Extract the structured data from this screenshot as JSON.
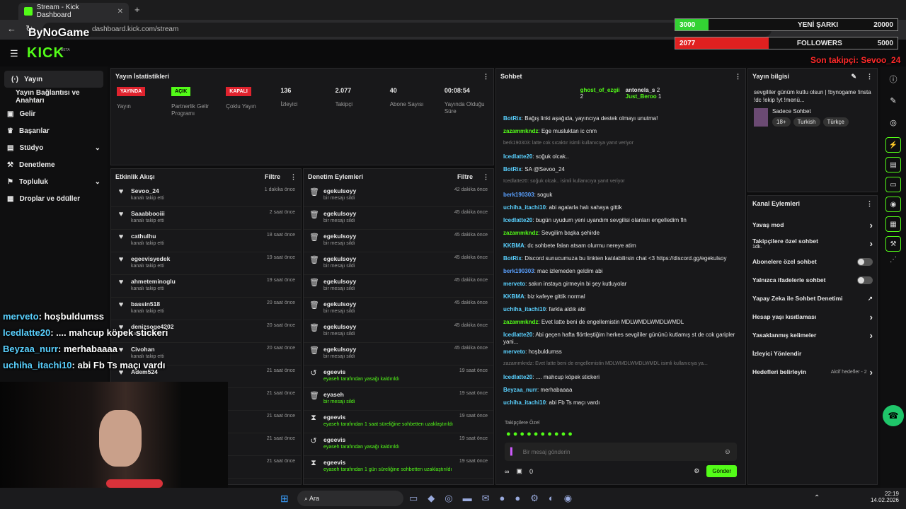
{
  "browser": {
    "tab_title": "Stream - Kick Dashboard",
    "url": "dashboard.kick.com/stream"
  },
  "brand": {
    "logo": "KICK",
    "beta": "BETA"
  },
  "sidebar": {
    "items": [
      {
        "label": "Yayın",
        "icon": "stream-icon"
      },
      {
        "label": "Yayın Bağlantısı ve Anahtarı",
        "icon": "key-icon"
      },
      {
        "label": "Gelir",
        "icon": "wallet-icon"
      },
      {
        "label": "Başarılar",
        "icon": "trophy-icon"
      },
      {
        "label": "Stüdyo",
        "icon": "studio-icon"
      },
      {
        "label": "Denetleme",
        "icon": "hammer-icon"
      },
      {
        "label": "Topluluk",
        "icon": "community-icon"
      },
      {
        "label": "Droplar ve ödüller",
        "icon": "drops-icon"
      }
    ]
  },
  "stats": {
    "title": "Yayın İstatistikleri",
    "items": [
      {
        "badge": "YAYINDA",
        "label": "Yayın"
      },
      {
        "badge": "AÇIK",
        "label": "Partnerlik Gelir Programı"
      },
      {
        "badge": "KAPALI",
        "label": "Çoklu Yayın"
      },
      {
        "value": "136",
        "label": "İzleyici"
      },
      {
        "value": "2.077",
        "label": "Takipçi"
      },
      {
        "value": "40",
        "label": "Abone Sayısı"
      },
      {
        "value": "00:08:54",
        "label": "Yayında Olduğu Süre"
      }
    ]
  },
  "activity": {
    "title": "Etkinlik Akışı",
    "filter": "Filtre",
    "rows": [
      {
        "name": "Sevoo_24",
        "sub": "kanalı takip etti",
        "time": "1 dakika önce"
      },
      {
        "name": "Saaabbooiii",
        "sub": "kanalı takip etti",
        "time": "2 saat önce"
      },
      {
        "name": "cathulhu",
        "sub": "kanalı takip etti",
        "time": "18 saat önce"
      },
      {
        "name": "egeevisyedek",
        "sub": "kanalı takip etti",
        "time": "19 saat önce"
      },
      {
        "name": "ahmeteminoglu",
        "sub": "kanalı takip etti",
        "time": "19 saat önce"
      },
      {
        "name": "bassin518",
        "sub": "kanalı takip etti",
        "time": "20 saat önce"
      },
      {
        "name": "denizsoge4202",
        "sub": "kanalı takip etti",
        "time": "20 saat önce"
      },
      {
        "name": "Civohan",
        "sub": "kanalı takip etti",
        "time": "20 saat önce"
      },
      {
        "name": "Adem524",
        "sub": "",
        "time": "21 saat önce"
      },
      {
        "name": "",
        "sub": "",
        "time": "21 saat önce"
      },
      {
        "name": "",
        "sub": "",
        "time": "21 saat önce"
      },
      {
        "name": "",
        "sub": "",
        "time": "21 saat önce"
      },
      {
        "name": "",
        "sub": "",
        "time": "21 saat önce"
      }
    ]
  },
  "mod": {
    "title": "Denetim Eylemleri",
    "filter": "Filtre",
    "rows": [
      {
        "icon": "trash-icon",
        "name": "egekulsoyy",
        "sub": "bir mesajı sildi",
        "time": "42 dakika önce"
      },
      {
        "icon": "trash-icon",
        "name": "egekulsoyy",
        "sub": "bir mesajı sildi",
        "time": "45 dakika önce"
      },
      {
        "icon": "trash-icon",
        "name": "egekulsoyy",
        "sub": "bir mesajı sildi",
        "time": "45 dakika önce"
      },
      {
        "icon": "trash-icon",
        "name": "egekulsoyy",
        "sub": "bir mesajı sildi",
        "time": "45 dakika önce"
      },
      {
        "icon": "trash-icon",
        "name": "egekulsoyy",
        "sub": "bir mesajı sildi",
        "time": "45 dakika önce"
      },
      {
        "icon": "trash-icon",
        "name": "egekulsoyy",
        "sub": "bir mesajı sildi",
        "time": "45 dakika önce"
      },
      {
        "icon": "trash-icon",
        "name": "egekulsoyy",
        "sub": "bir mesajı sildi",
        "time": "45 dakika önce"
      },
      {
        "icon": "trash-icon",
        "name": "egekulsoyy",
        "sub": "bir mesajı sildi",
        "time": "45 dakika önce"
      },
      {
        "icon": "undo-icon",
        "name": "egeevis",
        "sub": "eyaseh tarafından yasağı kaldırıldı",
        "time": "19 saat önce"
      },
      {
        "icon": "trash-icon",
        "name": "eyaseh",
        "sub": "bir mesajı sildi",
        "time": "19 saat önce"
      },
      {
        "icon": "hourglass-icon",
        "name": "egeevis",
        "sub": "eyaseh tarafından 1 saat süreliğine sohbetten uzaklaştırıldı",
        "time": "19 saat önce"
      },
      {
        "icon": "undo-icon",
        "name": "egeevis",
        "sub": "eyaseh tarafından yasağı kaldırıldı",
        "time": "19 saat önce"
      },
      {
        "icon": "hourglass-icon",
        "name": "egeevis",
        "sub": "eyaseh tarafından 1 gün süreliğine sohbetten uzaklaştırıldı",
        "time": "19 saat önce"
      }
    ]
  },
  "chat": {
    "title": "Sohbet",
    "top": [
      {
        "name": "ghost_of_ezgii",
        "count": "2"
      },
      {
        "name": "antonela_s",
        "count": "2"
      },
      {
        "name": "Just_Beroo",
        "count": "1"
      }
    ],
    "messages": [
      {
        "user": "BotRix",
        "color": "#5ad1ff",
        "text": "Bağış linki aşağıda, yayıncıya destek olmayı unutma!"
      },
      {
        "user": "zazammkndz",
        "color": "#53fc18",
        "text": "Ege musluktan ic cnm"
      },
      {
        "reply": "berk190303: latte cok sıcaktır isimli kullanıcıya yanıt veriyor"
      },
      {
        "user": "Icedlatte20",
        "color": "#5ad1ff",
        "text": "soğuk olcak.."
      },
      {
        "user": "BotRix",
        "color": "#5ad1ff",
        "text": "SA @Sevoo_24"
      },
      {
        "reply": "Icedlatte20: soğuk olcak.. isimli kullanıcıya yanıt veriyor"
      },
      {
        "user": "berk190303",
        "color": "#5aa0ff",
        "text": "soguk"
      },
      {
        "user": "uchiha_itachi10",
        "color": "#5ad1ff",
        "text": "abi agalarla halı sahaya gittik"
      },
      {
        "user": "Icedlatte20",
        "color": "#5ad1ff",
        "text": "bugün uyudum yeni uyandım sevgilisi olanları engelledim fln"
      },
      {
        "user": "zazammkndz",
        "color": "#53fc18",
        "text": "Sevgilim başka şehirde"
      },
      {
        "user": "KKBMA",
        "color": "#5ad1ff",
        "text": "dc sohbete falan atsam olurmu nereye atim"
      },
      {
        "user": "BotRix",
        "color": "#5ad1ff",
        "text": "Discord sunucumuza bu linkten katılabilirsin chat <3 https://discord.gg/egekulsoy"
      },
      {
        "user": "berk190303",
        "color": "#5aa0ff",
        "text": "mac izlemeden geldim abi"
      },
      {
        "user": "merveto",
        "color": "#5ad1ff",
        "text": "sakın instaya girmeyin bi şey kutluyolar"
      },
      {
        "user": "KKBMA",
        "color": "#5ad1ff",
        "text": "biz kafeye gittik normal"
      },
      {
        "user": "uchiha_itachi10",
        "color": "#5ad1ff",
        "text": "farkla aldık abi"
      },
      {
        "user": "zazammkndz",
        "color": "#53fc18",
        "text": "Evet latte beni de engellemistin MDLWMDLWMDLWMDL"
      },
      {
        "user": "Icedlatte20",
        "color": "#5ad1ff",
        "text": "Abi geçen hafta flörtleştiğim herkes sevgililer gününü kutlamış st de cok garipler yani..."
      },
      {
        "user": "merveto",
        "color": "#5ad1ff",
        "text": "hoşbuldumss"
      },
      {
        "reply": "zazammkndz: Evet latte beni de engellemistin MDLWMDLWMDLWMDL isimli kullanıcıya ya..."
      },
      {
        "user": "Icedlatte20",
        "color": "#5ad1ff",
        "text": ".... mahcup köpek stickeri"
      },
      {
        "user": "Beyzaa_nurr",
        "color": "#5ad1ff",
        "text": "merhabaaaa"
      },
      {
        "user": "uchiha_itachi10",
        "color": "#5ad1ff",
        "text": "abi Fb Ts maçı vardı"
      }
    ],
    "emote_label": "Takipçilere Özel",
    "placeholder": "Bir mesaj gönderin",
    "send": "Gönder",
    "points": "0"
  },
  "info": {
    "title": "Yayın bilgisi",
    "stream_title": "sevgililer günüm kutlu olsun | !bynogame !insta !dc !ekip !yt !menü...",
    "category": "Sadece Sohbet",
    "tags": [
      "18+",
      "Turkish",
      "Türkçe"
    ]
  },
  "channel": {
    "title": "Kanal Eylemleri",
    "items": [
      {
        "label": "Yavaş mod",
        "type": "chevron"
      },
      {
        "label": "Takipçilere özel sohbet",
        "sub": "1dk.",
        "type": "chevron"
      },
      {
        "label": "Abonelere özel sohbet",
        "type": "toggle"
      },
      {
        "label": "Yalnızca ifadelerle sohbet",
        "type": "toggle"
      },
      {
        "label": "Yapay Zeka ile Sohbet Denetimi",
        "type": "external"
      },
      {
        "label": "Hesap yaşı kısıtlaması",
        "type": "chevron"
      },
      {
        "label": "Yasaklanmış kelimeler",
        "type": "chevron"
      },
      {
        "label": "İzleyici Yönlendir",
        "type": "none"
      },
      {
        "label": "Hedefleri belirleyin",
        "sub": "Aktif hedefler - 2",
        "type": "chevron"
      }
    ]
  },
  "overlay": {
    "bar1_left": "3000",
    "bar1_label": "YENİ ŞARKI",
    "bar1_right": "20000",
    "bar1_fill": 0.15,
    "bar2_left": "2077",
    "bar2_label": "FOLLOWERS",
    "bar2_right": "5000",
    "bar2_fill": 0.42,
    "last_follower": "Son takipçi: Sevoo_24",
    "watermark": "ByNoGame",
    "chat": [
      {
        "user": "merveto",
        "text": ": hoşbuldumss",
        "color": "#5ad1ff"
      },
      {
        "user": "Icedlatte20",
        "text": ": .... mahcup köpek stickeri",
        "color": "#5ad1ff"
      },
      {
        "user": "Beyzaa_nurr",
        "text": ": merhabaaaa",
        "color": "#5ad1ff"
      },
      {
        "user": "uchiha_itachi10",
        "text": ": abi Fb Ts maçı vardı",
        "color": "#5ad1ff"
      }
    ]
  },
  "taskbar": {
    "search": "Ara",
    "time": "22:19",
    "date": "14.02.2026"
  }
}
